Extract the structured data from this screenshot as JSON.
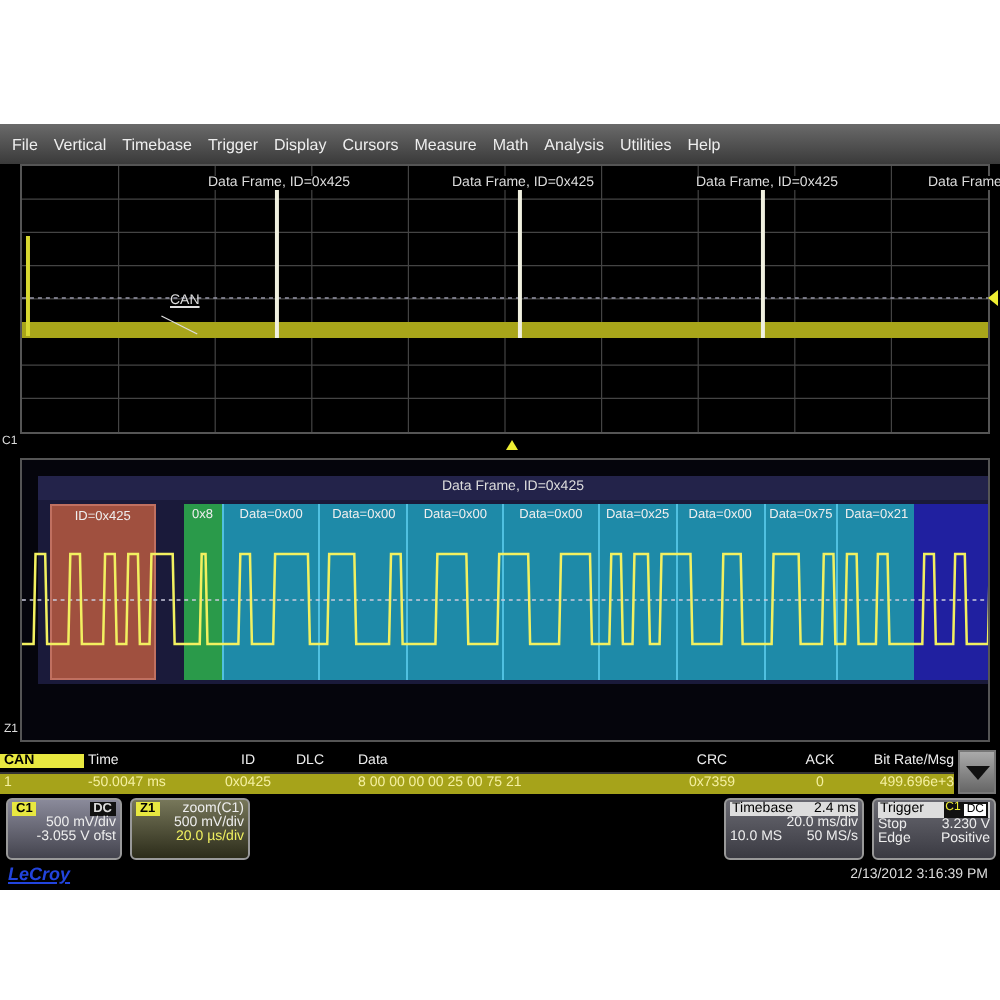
{
  "menu": [
    "File",
    "Vertical",
    "Timebase",
    "Trigger",
    "Display",
    "Cursors",
    "Measure",
    "Math",
    "Analysis",
    "Utilities",
    "Help"
  ],
  "overview": {
    "frame_labels": [
      "Data Frame, ID=0x425",
      "Data Frame, ID=0x425",
      "Data Frame, ID=0x425",
      "Data Frame"
    ],
    "trace_label": "CAN",
    "channel_marker": "C1"
  },
  "zoom": {
    "frame_label": "Data Frame, ID=0x425",
    "channel_marker": "Z1",
    "segments": [
      {
        "kind": "id",
        "label": "ID=0x425"
      },
      {
        "kind": "dlc",
        "label": "0x8"
      },
      {
        "kind": "data",
        "label": "Data=0x00"
      },
      {
        "kind": "data",
        "label": "Data=0x00"
      },
      {
        "kind": "data",
        "label": "Data=0x00"
      },
      {
        "kind": "data",
        "label": "Data=0x00"
      },
      {
        "kind": "data",
        "label": "Data=0x25"
      },
      {
        "kind": "data",
        "label": "Data=0x00"
      },
      {
        "kind": "data",
        "label": "Data=0x75"
      },
      {
        "kind": "data",
        "label": "Data=0x21"
      },
      {
        "kind": "crc"
      }
    ]
  },
  "table": {
    "columns": [
      "CAN",
      "Time",
      "ID",
      "DLC",
      "Data",
      "CRC",
      "ACK",
      "Bit Rate/Msg"
    ],
    "rows": [
      {
        "cells": [
          "1",
          "-50.0047 ms",
          "0x0425",
          "",
          "8 00 00 00 00 25 00 75 21",
          "0x7359",
          "0",
          "499.696e+3"
        ]
      }
    ]
  },
  "channels": [
    {
      "badge": "C1",
      "coupling": "DC",
      "scale": "500 mV/div",
      "offset": "-3.055 V ofst"
    },
    {
      "badge": "Z1",
      "source": "zoom(C1)",
      "scale": "500 mV/div",
      "timescale": "20.0 µs/div"
    }
  ],
  "timebase": {
    "title": "Timebase",
    "delay": "2.4 ms",
    "scale": "20.0 ms/div",
    "samples": "10.0 MS",
    "rate": "50 MS/s"
  },
  "trigger": {
    "title": "Trigger",
    "source": "C1",
    "coupling": "DC",
    "mode": "Stop",
    "level": "3.230 V",
    "type": "Edge",
    "slope": "Positive"
  },
  "brand": "LeCroy",
  "datetime": "2/13/2012 3:16:39 PM"
}
